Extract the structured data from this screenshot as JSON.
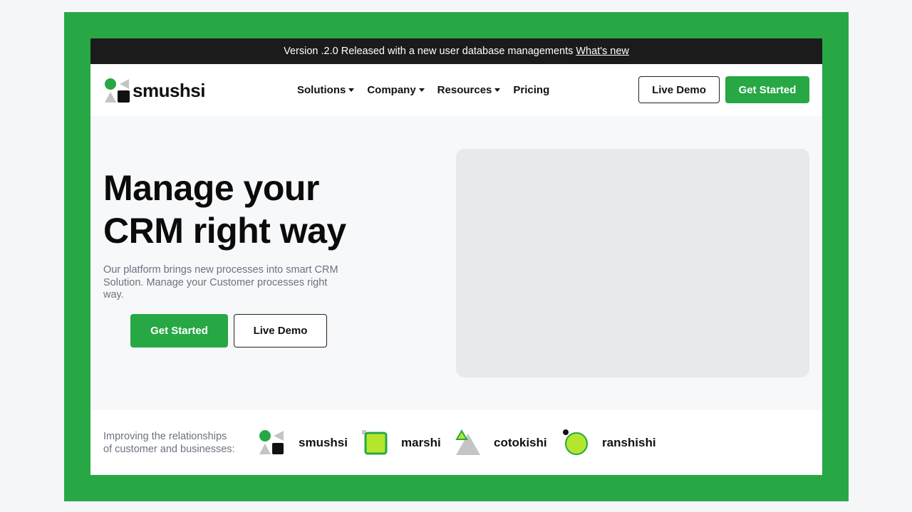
{
  "announcement": {
    "text": "Version .2.0 Released with a new user database managements",
    "link": "What's new"
  },
  "brand": {
    "name": "smushsi"
  },
  "nav": {
    "items": [
      {
        "label": "Solutions",
        "dropdown": true
      },
      {
        "label": "Company",
        "dropdown": true
      },
      {
        "label": "Resources",
        "dropdown": true
      },
      {
        "label": "Pricing",
        "dropdown": false
      }
    ],
    "live_demo": "Live Demo",
    "get_started": "Get Started"
  },
  "hero": {
    "title_line1": "Manage your",
    "title_line2": "CRM right way",
    "subtitle": "Our platform brings new processes into smart CRM Solution. Manage your Customer processes right way.",
    "get_started": "Get Started",
    "live_demo": "Live Demo"
  },
  "partners": {
    "text_line1": "Improving the relationships",
    "text_line2": "of customer and businesses:",
    "logos": [
      {
        "name": "smushsi",
        "icon": "shapes-icon"
      },
      {
        "name": "marshi",
        "icon": "square-icon"
      },
      {
        "name": "cotokishi",
        "icon": "triangle-icon"
      },
      {
        "name": "ranshishi",
        "icon": "circle-icon"
      }
    ]
  },
  "colors": {
    "accent": "#27a844",
    "lime": "#b5e62e",
    "dark": "#1b1b1b",
    "placeholder": "#e7eaed"
  }
}
